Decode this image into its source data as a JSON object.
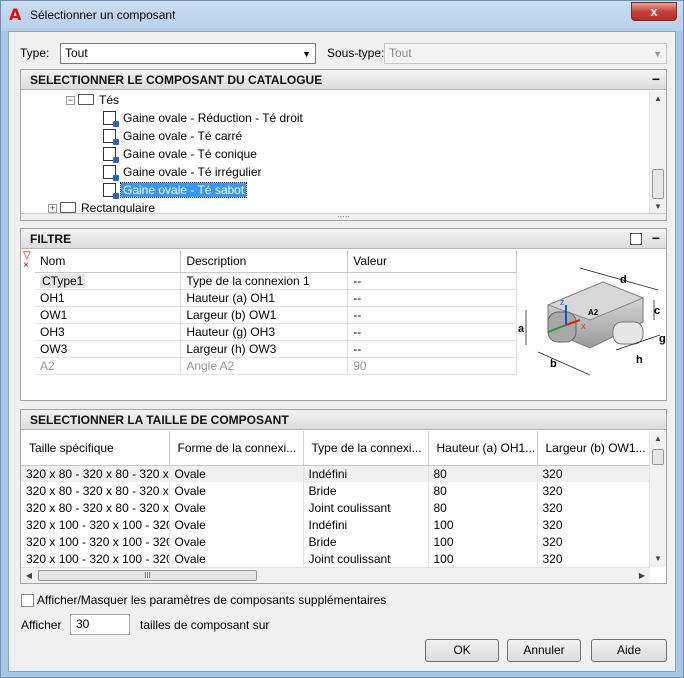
{
  "window": {
    "title": "Sélectionner un composant",
    "close_glyph": "x"
  },
  "type_row": {
    "type_label": "Type:",
    "type_value": "Tout",
    "subtype_label": "Sous-type:",
    "subtype_value": "Tout"
  },
  "catalog": {
    "header": "SELECTIONNER LE COMPOSANT DU CATALOGUE",
    "tree": [
      {
        "label": "Tés",
        "kind": "folder-open"
      },
      {
        "label": "Gaine ovale - Réduction - Té droit",
        "kind": "item"
      },
      {
        "label": "Gaine ovale - Té carré",
        "kind": "item"
      },
      {
        "label": "Gaine ovale - Té conique",
        "kind": "item"
      },
      {
        "label": "Gaine ovale - Té irrégulier",
        "kind": "item"
      },
      {
        "label": "Gaine ovale - Té sabot",
        "kind": "item",
        "selected": true
      },
      {
        "label": "Rectangulaire",
        "kind": "folder"
      }
    ]
  },
  "filter": {
    "header": "FILTRE",
    "columns": [
      "Nom",
      "Description",
      "Valeur"
    ],
    "rows": [
      {
        "name": "CType1",
        "description": "Type de la connexion 1",
        "value": "--"
      },
      {
        "name": "OH1",
        "description": "Hauteur (a) OH1",
        "value": "--"
      },
      {
        "name": "OW1",
        "description": "Largeur (b) OW1",
        "value": "--"
      },
      {
        "name": "OH3",
        "description": "Hauteur (g) OH3",
        "value": "--"
      },
      {
        "name": "OW3",
        "description": "Largeur (h) OW3",
        "value": "--"
      },
      {
        "name": "A2",
        "description": "Angle A2",
        "value": "90",
        "dim": true
      }
    ],
    "diagram_labels": {
      "a": "a",
      "b": "b",
      "c": "c",
      "d": "d",
      "g": "g",
      "h": "h",
      "a2": "A2",
      "x": "X",
      "z": "Z"
    }
  },
  "sizes": {
    "header": "SELECTIONNER LA TAILLE DE COMPOSANT",
    "columns": [
      "Taille spécifique",
      "Forme de la connexi...",
      "Type de la connexi...",
      "Hauteur (a) OH1...",
      "Largeur (b) OW1..."
    ],
    "rows": [
      [
        "320 x 80 - 320 x 80 - 320 x ...",
        "Ovale",
        "Indéfini",
        "80",
        "320"
      ],
      [
        "320 x 80 - 320 x 80 - 320 x ...",
        "Ovale",
        "Bride",
        "80",
        "320"
      ],
      [
        "320 x 80 - 320 x 80 - 320 x ...",
        "Ovale",
        "Joint coulissant",
        "80",
        "320"
      ],
      [
        "320 x 100 - 320 x 100 - 320 ...",
        "Ovale",
        "Indéfini",
        "100",
        "320"
      ],
      [
        "320 x 100 - 320 x 100 - 320 ...",
        "Ovale",
        "Bride",
        "100",
        "320"
      ],
      [
        "320 x 100 - 320 x 100 - 320 ...",
        "Ovale",
        "Joint coulissant",
        "100",
        "320"
      ]
    ],
    "scroll_grip": "III"
  },
  "footer": {
    "toggle_label": "Afficher/Masquer les paramètres de composants supplémentaires",
    "show_label": "Afficher",
    "show_count": "30",
    "show_suffix": "tailles de composant sur",
    "ok": "OK",
    "cancel": "Annuler",
    "help": "Aide"
  }
}
